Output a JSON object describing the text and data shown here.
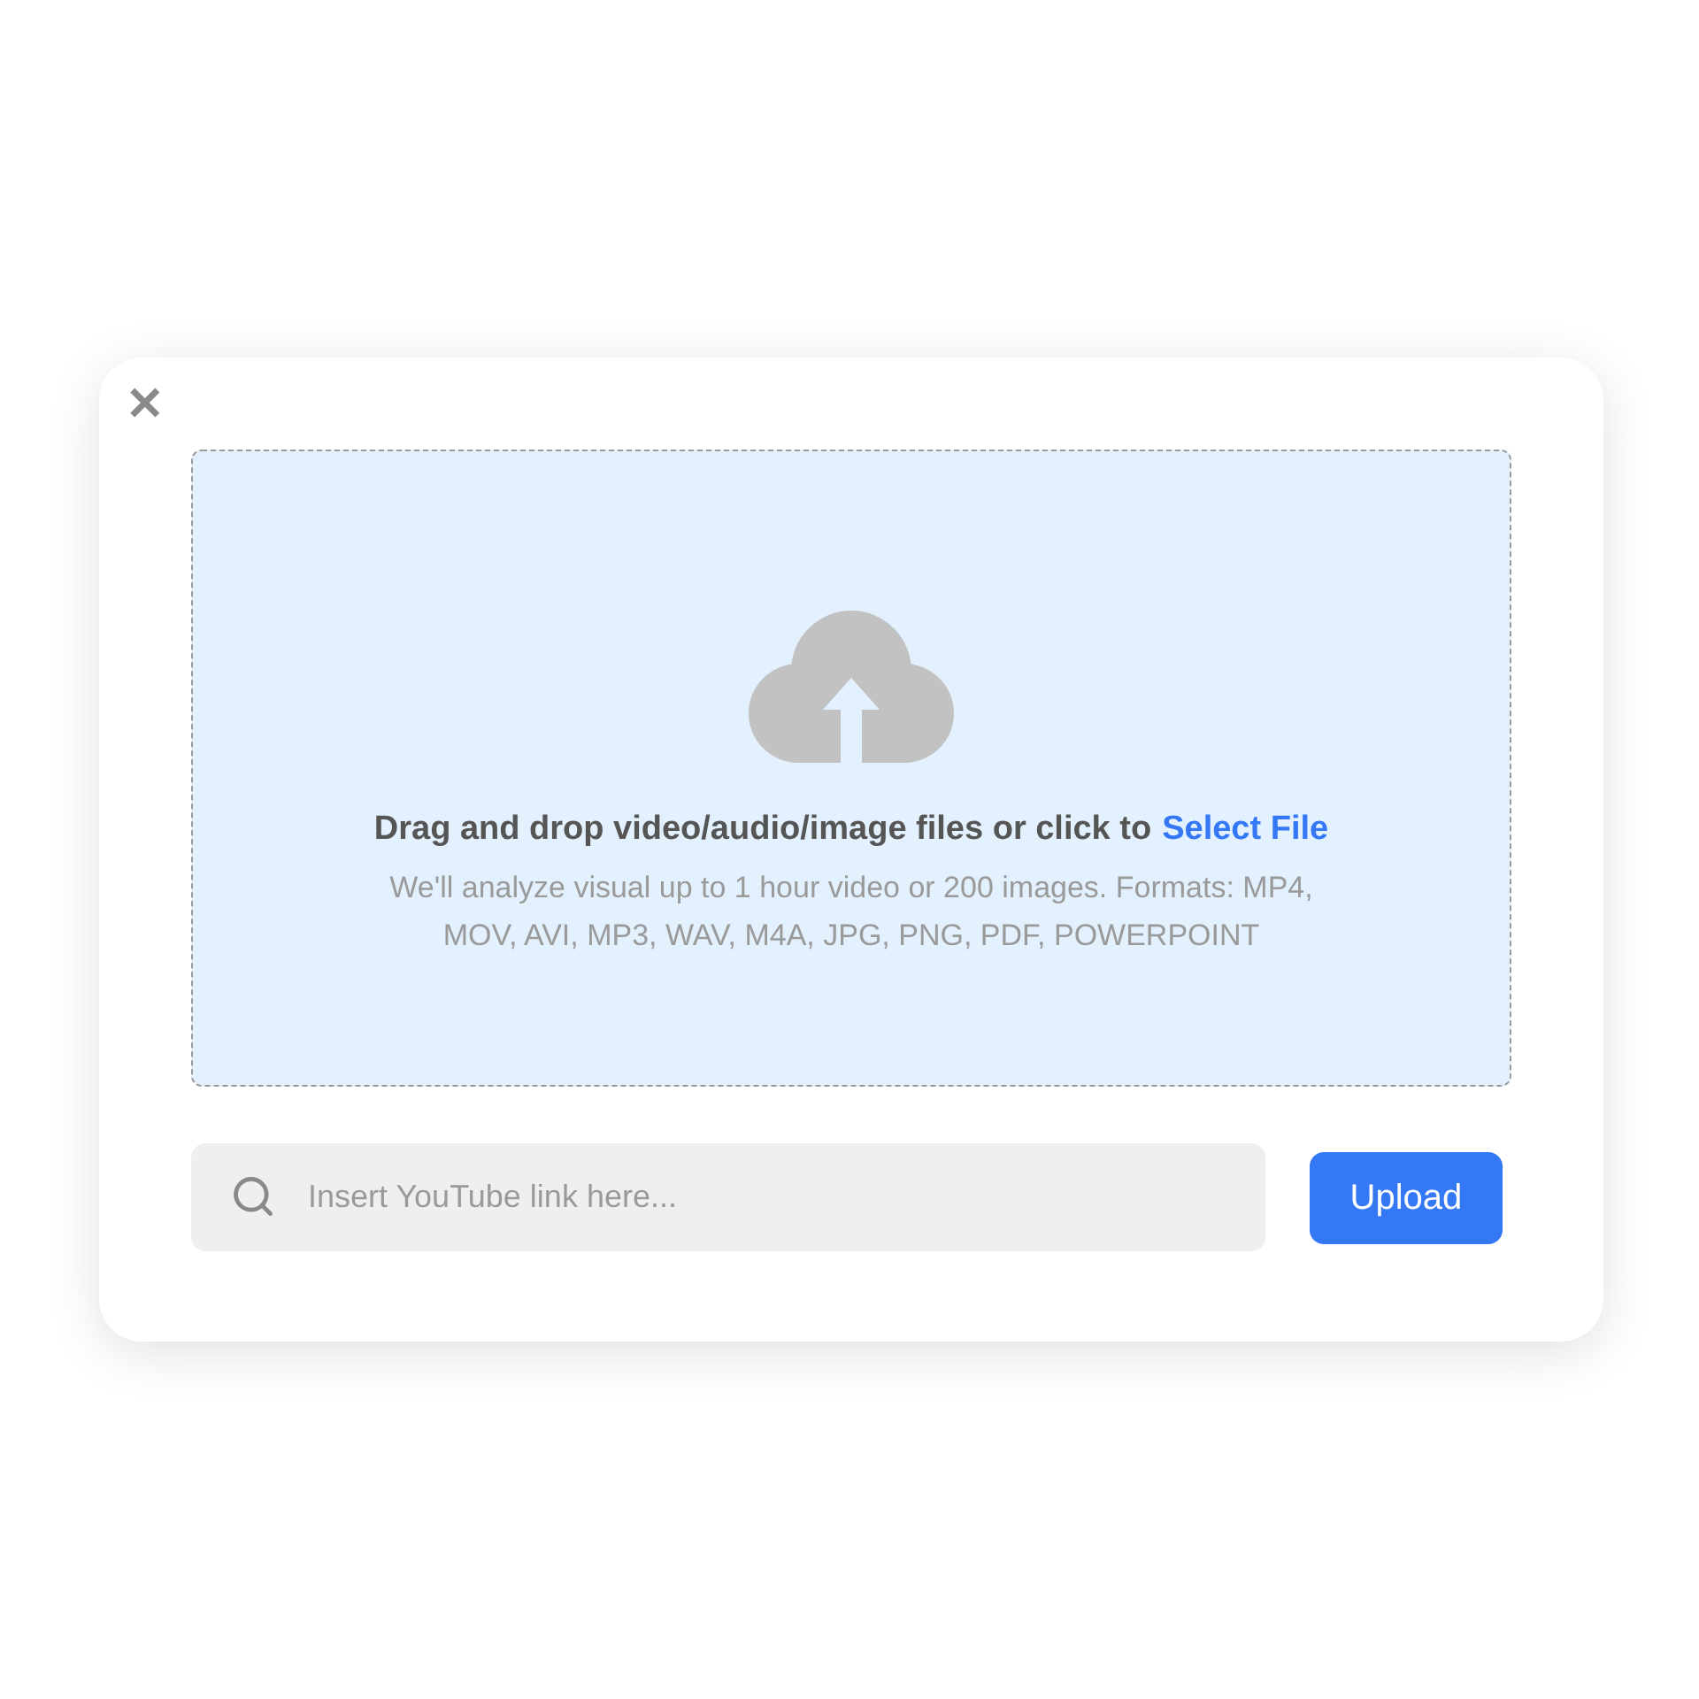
{
  "dialog": {
    "close": "✕",
    "dropzone": {
      "title": "Drag and drop video/audio/image files or click to",
      "link": "Select File",
      "hint": "We'll analyze visual up to 1 hour video or 200 images. Formats: MP4, MOV, AVI, MP3, WAV, M4A, JPG, PNG, PDF, POWERPOINT"
    },
    "link_field": {
      "placeholder": "Insert YouTube link here..."
    },
    "upload_button": "Upload"
  }
}
